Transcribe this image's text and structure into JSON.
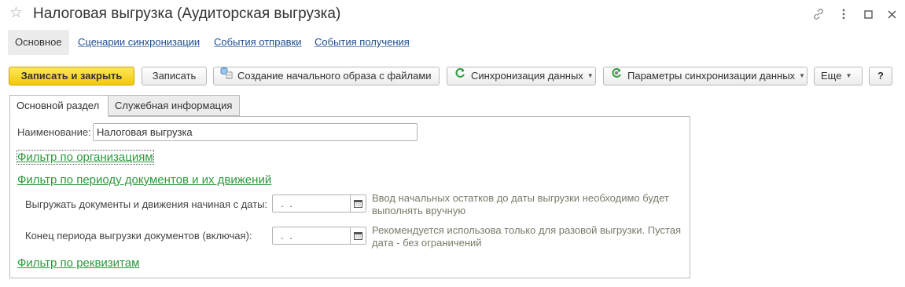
{
  "window": {
    "title": "Налоговая выгрузка (Аудиторская выгрузка)",
    "icons": [
      "star-icon",
      "link-icon",
      "more-icon",
      "maximize-icon",
      "close-icon"
    ]
  },
  "nav": {
    "tabs": [
      {
        "label": "Основное",
        "active": true
      },
      {
        "label": "Сценарии синхронизации",
        "active": false
      },
      {
        "label": "События отправки",
        "active": false
      },
      {
        "label": "События получения",
        "active": false
      }
    ]
  },
  "toolbar": {
    "save_close": "Записать и закрыть",
    "save": "Записать",
    "initial_image": "Создание начального образа с файлами",
    "sync": "Синхронизация данных",
    "sync_params": "Параметры синхронизации данных",
    "more": "Еще",
    "help": "?"
  },
  "form_tabs": {
    "main": "Основной раздел",
    "service": "Служебная информация"
  },
  "form": {
    "name_label": "Наименование:",
    "name_value": "Налоговая выгрузка",
    "filter_orgs": "Фильтр по организациям",
    "filter_period": "Фильтр по периоду документов и их движений",
    "start_date_label": "Выгружать документы и движения начиная с даты:",
    "start_date_value": " .  .",
    "start_date_hint_1": "Ввод начальных остатков до даты выгрузки необходимо будет",
    "start_date_hint_2": "выполнять вручную",
    "end_date_label": "Конец периода выгрузки документов (включая):",
    "end_date_value": " .  .",
    "end_date_hint_1": "Рекомендуется использова только для разовой выгрузки. Пустая",
    "end_date_hint_2": "дата - без ограничений",
    "filter_attrs": "Фильтр по реквизитам"
  }
}
